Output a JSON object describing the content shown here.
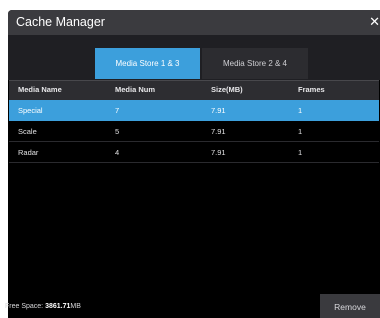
{
  "window": {
    "title": "Cache Manager",
    "close_glyph": "✕"
  },
  "tabs": [
    {
      "label": "Media Store 1 & 3",
      "selected": true
    },
    {
      "label": "Media Store 2 & 4",
      "selected": false
    }
  ],
  "table": {
    "columns": [
      "Media Name",
      "Media Num",
      "Size(MB)",
      "Frames"
    ],
    "rows": [
      {
        "cells": [
          "Special",
          "7",
          "7.91",
          "1"
        ],
        "selected": true
      },
      {
        "cells": [
          "Scale",
          "5",
          "7.91",
          "1"
        ],
        "selected": false
      },
      {
        "cells": [
          "Radar",
          "4",
          "7.91",
          "1"
        ],
        "selected": false
      }
    ]
  },
  "footer": {
    "free_space_label": "Free Space:",
    "free_space_value": "3861.71",
    "free_space_unit": "MB",
    "remove_label": "Remove"
  },
  "colors": {
    "accent": "#3c9fdc",
    "background": "#000000",
    "titlebar": "#3b3b3f"
  }
}
